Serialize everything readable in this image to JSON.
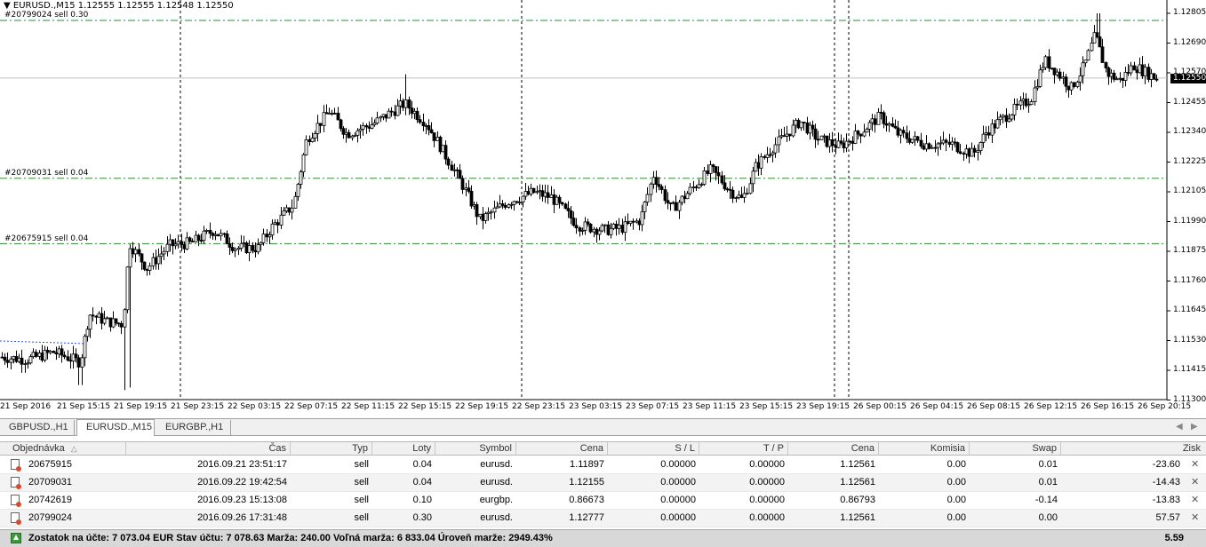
{
  "chart": {
    "header": "EURUSD.,M15  1.12555 1.12555 1.12548 1.12550",
    "current_price": "1.12550",
    "order_lines": [
      {
        "label": "#20799024 sell 0.30",
        "price": 1.12777
      },
      {
        "label": "#20709031 sell 0.04",
        "price": 1.12155
      },
      {
        "label": "#20675915 sell 0.04",
        "price": 1.11897
      }
    ],
    "price_ticks": [
      "1.12805",
      "1.12690",
      "1.12570",
      "1.12455",
      "1.12340",
      "1.12225",
      "1.12105",
      "1.11990",
      "1.11875",
      "1.11760",
      "1.11645",
      "1.11530",
      "1.11415",
      "1.11300"
    ],
    "time_ticks": [
      "21 Sep 2016",
      "21 Sep 15:15",
      "21 Sep 19:15",
      "21 Sep 23:15",
      "22 Sep 03:15",
      "22 Sep 07:15",
      "22 Sep 11:15",
      "22 Sep 15:15",
      "22 Sep 19:15",
      "22 Sep 23:15",
      "23 Sep 03:15",
      "23 Sep 07:15",
      "23 Sep 11:15",
      "23 Sep 15:15",
      "23 Sep 19:15",
      "26 Sep 00:15",
      "26 Sep 04:15",
      "26 Sep 08:15",
      "26 Sep 12:15",
      "26 Sep 16:15",
      "26 Sep 20:15"
    ],
    "colors": {
      "order_line": "#2e8b2e",
      "candle": "#000000",
      "separator": "#000000"
    }
  },
  "tabs": {
    "items": [
      {
        "label": "GBPUSD.,H1",
        "active": false
      },
      {
        "label": "EURUSD.,M15",
        "active": true
      },
      {
        "label": "EURGBP.,H1",
        "active": false
      }
    ],
    "left_arrow_icon": "chevron-left-icon",
    "right_arrow_icon": "chevron-right-icon"
  },
  "trade": {
    "columns": [
      "Objednávka",
      "Čas",
      "Typ",
      "Loty",
      "Symbol",
      "Cena",
      "S / L",
      "T / P",
      "Cena",
      "Komisia",
      "Swap",
      "Zisk"
    ],
    "sort_indicator": "△",
    "rows": [
      {
        "order": "20675915",
        "time": "2016.09.21 23:51:17",
        "type": "sell",
        "lots": "0.04",
        "symbol": "eurusd.",
        "price": "1.11897",
        "sl": "0.00000",
        "tp": "0.00000",
        "cur": "1.12561",
        "commission": "0.00",
        "swap": "0.01",
        "profit": "-23.60"
      },
      {
        "order": "20709031",
        "time": "2016.09.22 19:42:54",
        "type": "sell",
        "lots": "0.04",
        "symbol": "eurusd.",
        "price": "1.12155",
        "sl": "0.00000",
        "tp": "0.00000",
        "cur": "1.12561",
        "commission": "0.00",
        "swap": "0.01",
        "profit": "-14.43"
      },
      {
        "order": "20742619",
        "time": "2016.09.23 15:13:08",
        "type": "sell",
        "lots": "0.10",
        "symbol": "eurgbp.",
        "price": "0.86673",
        "sl": "0.00000",
        "tp": "0.00000",
        "cur": "0.86793",
        "commission": "0.00",
        "swap": "-0.14",
        "profit": "-13.83"
      },
      {
        "order": "20799024",
        "time": "2016.09.26 17:31:48",
        "type": "sell",
        "lots": "0.30",
        "symbol": "eurusd.",
        "price": "1.12777",
        "sl": "0.00000",
        "tp": "0.00000",
        "cur": "1.12561",
        "commission": "0.00",
        "swap": "0.00",
        "profit": "57.57"
      }
    ],
    "summary": "Zostatok na účte: 7 073.04 EUR  Stav účtu: 7 078.63  Marža: 240.00  Voľná marža: 6 833.04  Úroveň marže: 2949.43%",
    "summary_total": "5.59",
    "close_icon": "close-icon"
  }
}
